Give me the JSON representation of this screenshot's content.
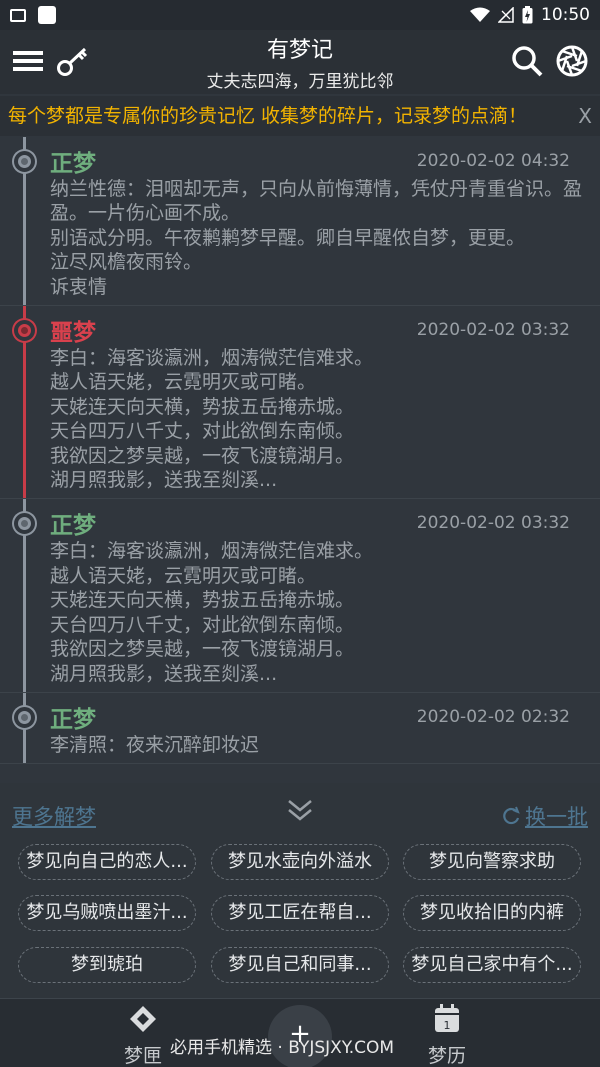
{
  "status": {
    "time": "10:50"
  },
  "header": {
    "title": "有梦记",
    "subtitle": "丈夫志四海，万里犹比邻"
  },
  "marquee": {
    "text": "每个梦都是专属你的珍贵记忆 收集梦的碎片，记录梦的点滴！",
    "close": "X"
  },
  "entries": [
    {
      "tag": "正梦",
      "date": "2020-02-02 04:32",
      "body": "纳兰性德：泪咽却无声，只向从前悔薄情，凭仗丹青重省识。盈盈。一片伤心画不成。\n别语忒分明。午夜鹣鹣梦早醒。卿自早醒侬自梦，更更。\n泣尽风檐夜雨铃。\n诉衷情"
    },
    {
      "tag": "噩梦",
      "date": "2020-02-02 03:32",
      "body": "李白：海客谈瀛洲，烟涛微茫信难求。\n越人语天姥，云霓明灭或可睹。\n天姥连天向天横，势拔五岳掩赤城。\n天台四万八千丈，对此欲倒东南倾。\n我欲因之梦吴越，一夜飞渡镜湖月。\n湖月照我影，送我至剡溪..."
    },
    {
      "tag": "正梦",
      "date": "2020-02-02 03:32",
      "body": "李白：海客谈瀛洲，烟涛微茫信难求。\n越人语天姥，云霓明灭或可睹。\n天姥连天向天横，势拔五岳掩赤城。\n天台四万八千丈，对此欲倒东南倾。\n我欲因之梦吴越，一夜飞渡镜湖月。\n湖月照我影，送我至剡溪..."
    },
    {
      "tag": "正梦",
      "date": "2020-02-02 02:32",
      "body": "李清照：夜来沉醉卸妆迟"
    }
  ],
  "recommend": {
    "more": "更多解梦",
    "refresh": "换一批",
    "chips": [
      "梦见向自己的恋人...",
      "梦见水壶向外溢水",
      "梦见向警察求助",
      "梦见乌贼喷出墨汁...",
      "梦见工匠在帮自...",
      "梦见收拾旧的内裤",
      "梦到琥珀",
      "梦见自己和同事...",
      "梦见自己家中有个..."
    ]
  },
  "nav": {
    "left": "梦匣",
    "right": "梦历",
    "fab": "+",
    "calendar_day": "1"
  },
  "watermark": "必用手机精选 · BYJSJXY.COM",
  "colors": {
    "good": "#6fae7e",
    "bad": "#d9414d",
    "accent": "#f2b300",
    "link": "#4e7590"
  }
}
